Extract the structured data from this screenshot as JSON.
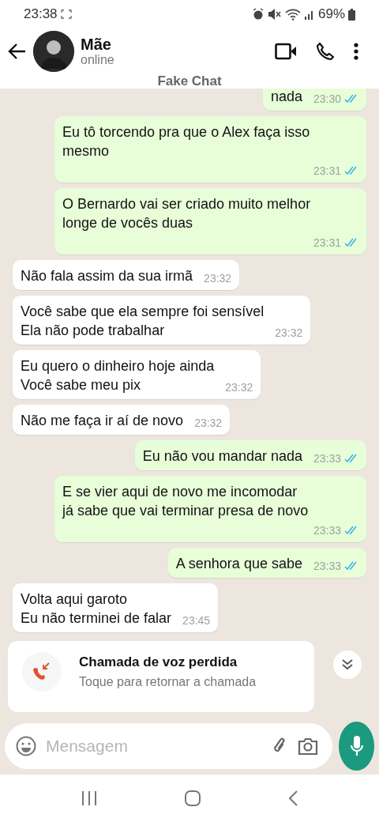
{
  "status_bar": {
    "time": "23:38",
    "battery": "69%"
  },
  "header": {
    "name": "Mãe",
    "status": "online",
    "caption": "Fake Chat"
  },
  "messages": [
    {
      "kind": "message",
      "outgoing": true,
      "text": "nada",
      "time": "23:30",
      "read": true
    },
    {
      "kind": "message",
      "outgoing": true,
      "text": "Eu tô torcendo pra que o Alex faça isso\nmesmo",
      "time": "23:31",
      "read": true
    },
    {
      "kind": "message",
      "outgoing": true,
      "text": "O Bernardo vai ser criado muito melhor\nlonge de vocês duas",
      "time": "23:31",
      "read": true
    },
    {
      "kind": "message",
      "outgoing": false,
      "text": "Não fala assim da sua irmã",
      "time": "23:32"
    },
    {
      "kind": "message",
      "outgoing": false,
      "text": "Você sabe que ela sempre foi sensível\nEla não pode trabalhar",
      "time": "23:32"
    },
    {
      "kind": "message",
      "outgoing": false,
      "text": "Eu quero o dinheiro hoje ainda\nVocê sabe meu pix",
      "time": "23:32"
    },
    {
      "kind": "message",
      "outgoing": false,
      "text": "Não me faça ir aí de novo",
      "time": "23:32"
    },
    {
      "kind": "message",
      "outgoing": true,
      "text": "Eu não vou mandar nada",
      "time": "23:33",
      "read": true
    },
    {
      "kind": "message",
      "outgoing": true,
      "text": "E se vier aqui de novo me incomodar\njá sabe que vai terminar presa de novo",
      "time": "23:33",
      "read": true
    },
    {
      "kind": "message",
      "outgoing": true,
      "text": "A senhora que sabe",
      "time": "23:33",
      "read": true
    },
    {
      "kind": "message",
      "outgoing": false,
      "text": "Volta aqui garoto\nEu não terminei de falar",
      "time": "23:45"
    },
    {
      "kind": "missed_call",
      "title": "Chamada de voz perdida",
      "subtitle": "Toque para retornar a chamada"
    }
  ],
  "composer": {
    "placeholder": "Mensagem"
  }
}
